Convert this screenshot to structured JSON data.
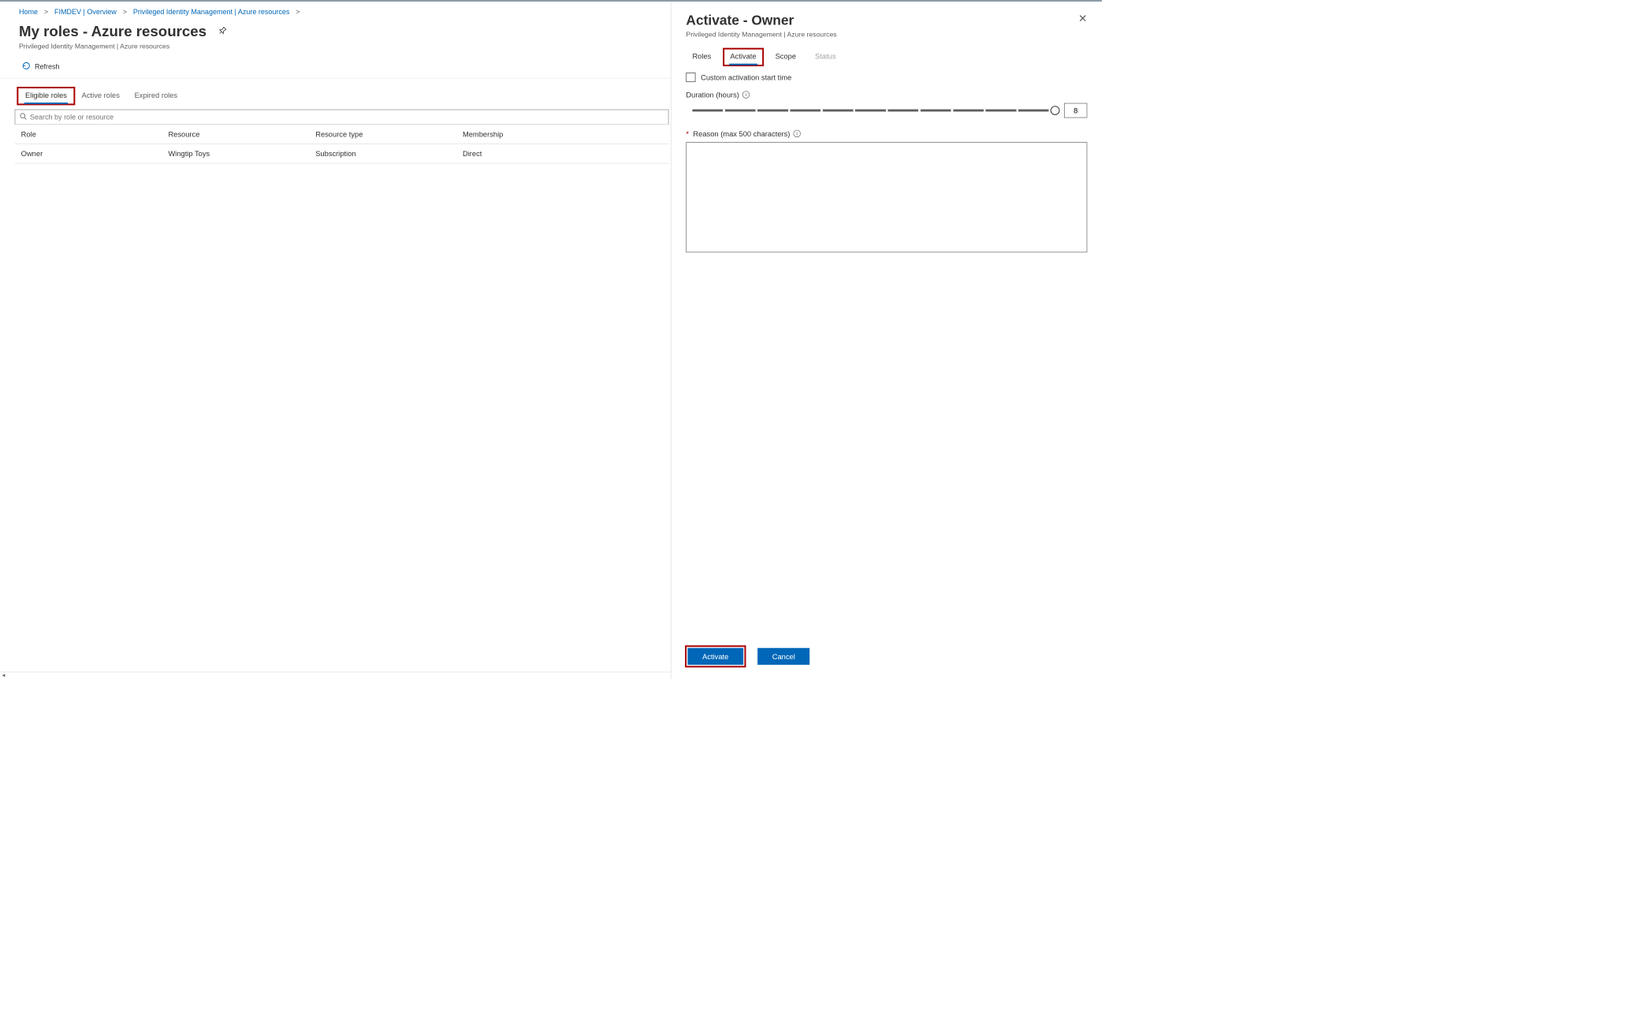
{
  "breadcrumb": {
    "items": [
      "Home",
      "FIMDEV | Overview",
      "Privileged Identity Management | Azure resources"
    ]
  },
  "page": {
    "title": "My roles - Azure resources",
    "subtitle": "Privileged Identity Management | Azure resources"
  },
  "toolbar": {
    "refresh_label": "Refresh"
  },
  "tabs": {
    "items": [
      "Eligible roles",
      "Active roles",
      "Expired roles"
    ],
    "active_index": 0
  },
  "search": {
    "placeholder": "Search by role or resource"
  },
  "table": {
    "headers": [
      "Role",
      "Resource",
      "Resource type",
      "Membership"
    ],
    "rows": [
      {
        "role": "Owner",
        "resource": "Wingtip Toys",
        "resource_type": "Subscription",
        "membership": "Direct"
      }
    ]
  },
  "panel": {
    "title": "Activate - Owner",
    "subtitle": "Privileged Identity Management | Azure resources",
    "tabs": {
      "items": [
        "Roles",
        "Activate",
        "Scope",
        "Status"
      ],
      "active_index": 1,
      "disabled_indices": [
        3
      ]
    },
    "custom_start_label": "Custom activation start time",
    "duration_label": "Duration (hours)",
    "duration_value": "8",
    "reason_label": "Reason (max 500 characters)",
    "footer": {
      "activate_label": "Activate",
      "cancel_label": "Cancel"
    }
  },
  "colors": {
    "link": "#0067b8",
    "highlight": "#a80000"
  }
}
